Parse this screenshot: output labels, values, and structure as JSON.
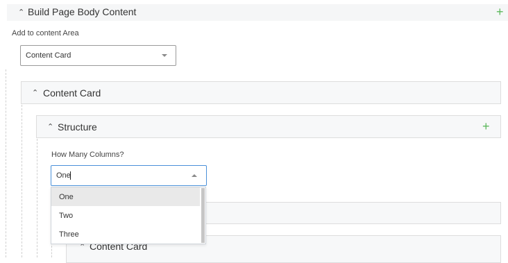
{
  "build_section": {
    "title": "Build Page Body Content",
    "add_label": "Add to content Area",
    "selected_value": "Content Card"
  },
  "content_card": {
    "title": "Content Card"
  },
  "structure": {
    "title": "Structure",
    "columns_label": "How Many Columns?",
    "columns_value": "One",
    "options": [
      "One",
      "Two",
      "Three"
    ]
  },
  "nested_card": {
    "title": "Content Card"
  },
  "icons": {
    "collapse": "caret-up",
    "add": "plus",
    "dropdown": "triangle-down",
    "dropdown_open": "triangle-up"
  },
  "colors": {
    "add_green": "#5cb85c",
    "panel_bg": "#f7f8f9"
  }
}
